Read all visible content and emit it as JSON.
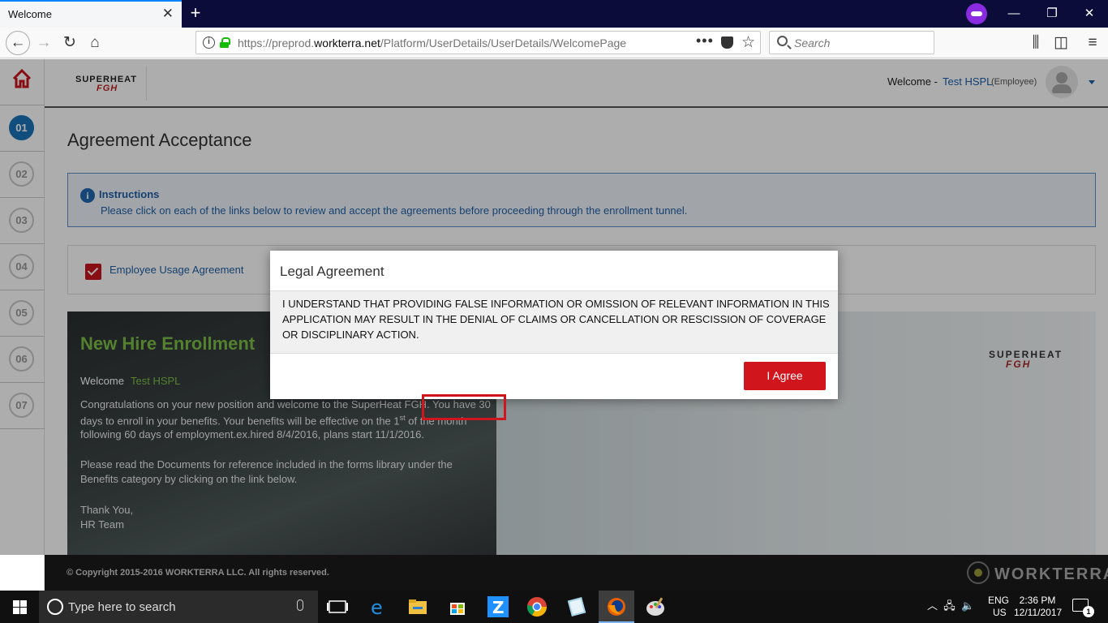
{
  "browser": {
    "tab_title": "Welcome",
    "url_prefix": "https://preprod.",
    "url_domain": "workterra.net",
    "url_path": "/Platform/UserDetails/UserDetails/WelcomePage",
    "search_placeholder": "Search",
    "url_dots": "•••"
  },
  "header": {
    "logo_top": "SUPERHEAT",
    "logo_sub": "FGH",
    "welcome_label": "Welcome -",
    "user_name": "Test HSPL",
    "user_role": "(Employee)"
  },
  "sidebar": {
    "steps": [
      "01",
      "02",
      "03",
      "04",
      "05",
      "06",
      "07"
    ],
    "active_step": "01"
  },
  "page": {
    "title": "Agreement Acceptance",
    "instructions_heading": "Instructions",
    "instructions_body": "Please click on each of the links below to review and accept the agreements before proceeding through the enrollment tunnel.",
    "agreement_link": "Employee Usage Agreement"
  },
  "banner": {
    "title": "New Hire Enrollment",
    "welcome_label": "Welcome",
    "welcome_name": "Test HSPL",
    "line1": "Congratulations on your new position and welcome to the SuperHeat FGH. You have 30",
    "line2a": "days to enroll in your benefits. Your benefits will be effective on the 1",
    "line2_sup": "st",
    "line2b": " of the month",
    "line3": "following 60 days of employment.ex.hired 8/4/2016, plans start 11/1/2016.",
    "line4": "Please read the Documents for reference included in the forms library under the",
    "line5": "Benefits category by clicking on the link below.",
    "line6": "Thank You,",
    "line7": "HR Team",
    "logo_top": "SUPERHEAT",
    "logo_sub": "FGH"
  },
  "modal": {
    "title": "Legal Agreement",
    "body": "I UNDERSTAND THAT PROVIDING FALSE INFORMATION OR OMISSION OF RELEVANT INFORMATION IN THIS APPLICATION MAY RESULT IN THE DENIAL OF CLAIMS OR CANCELLATION OR RESCISSION OF COVERAGE OR DISCIPLINARY ACTION.",
    "agree_button": "I Agree"
  },
  "footer": {
    "copyright": "© Copyright 2015-2016 WORKTERRA LLC. All rights reserved.",
    "brand": "WORKTERRA"
  },
  "taskbar": {
    "search_placeholder": "Type here to search",
    "lang_line1": "ENG",
    "lang_line2": "US",
    "time": "2:36 PM",
    "date": "12/11/2017",
    "notification_count": "1"
  },
  "colors": {
    "accent_red": "#d0151d",
    "link_blue": "#1f5fa5",
    "green": "#7cbf47",
    "active_step": "#1a73b8"
  }
}
